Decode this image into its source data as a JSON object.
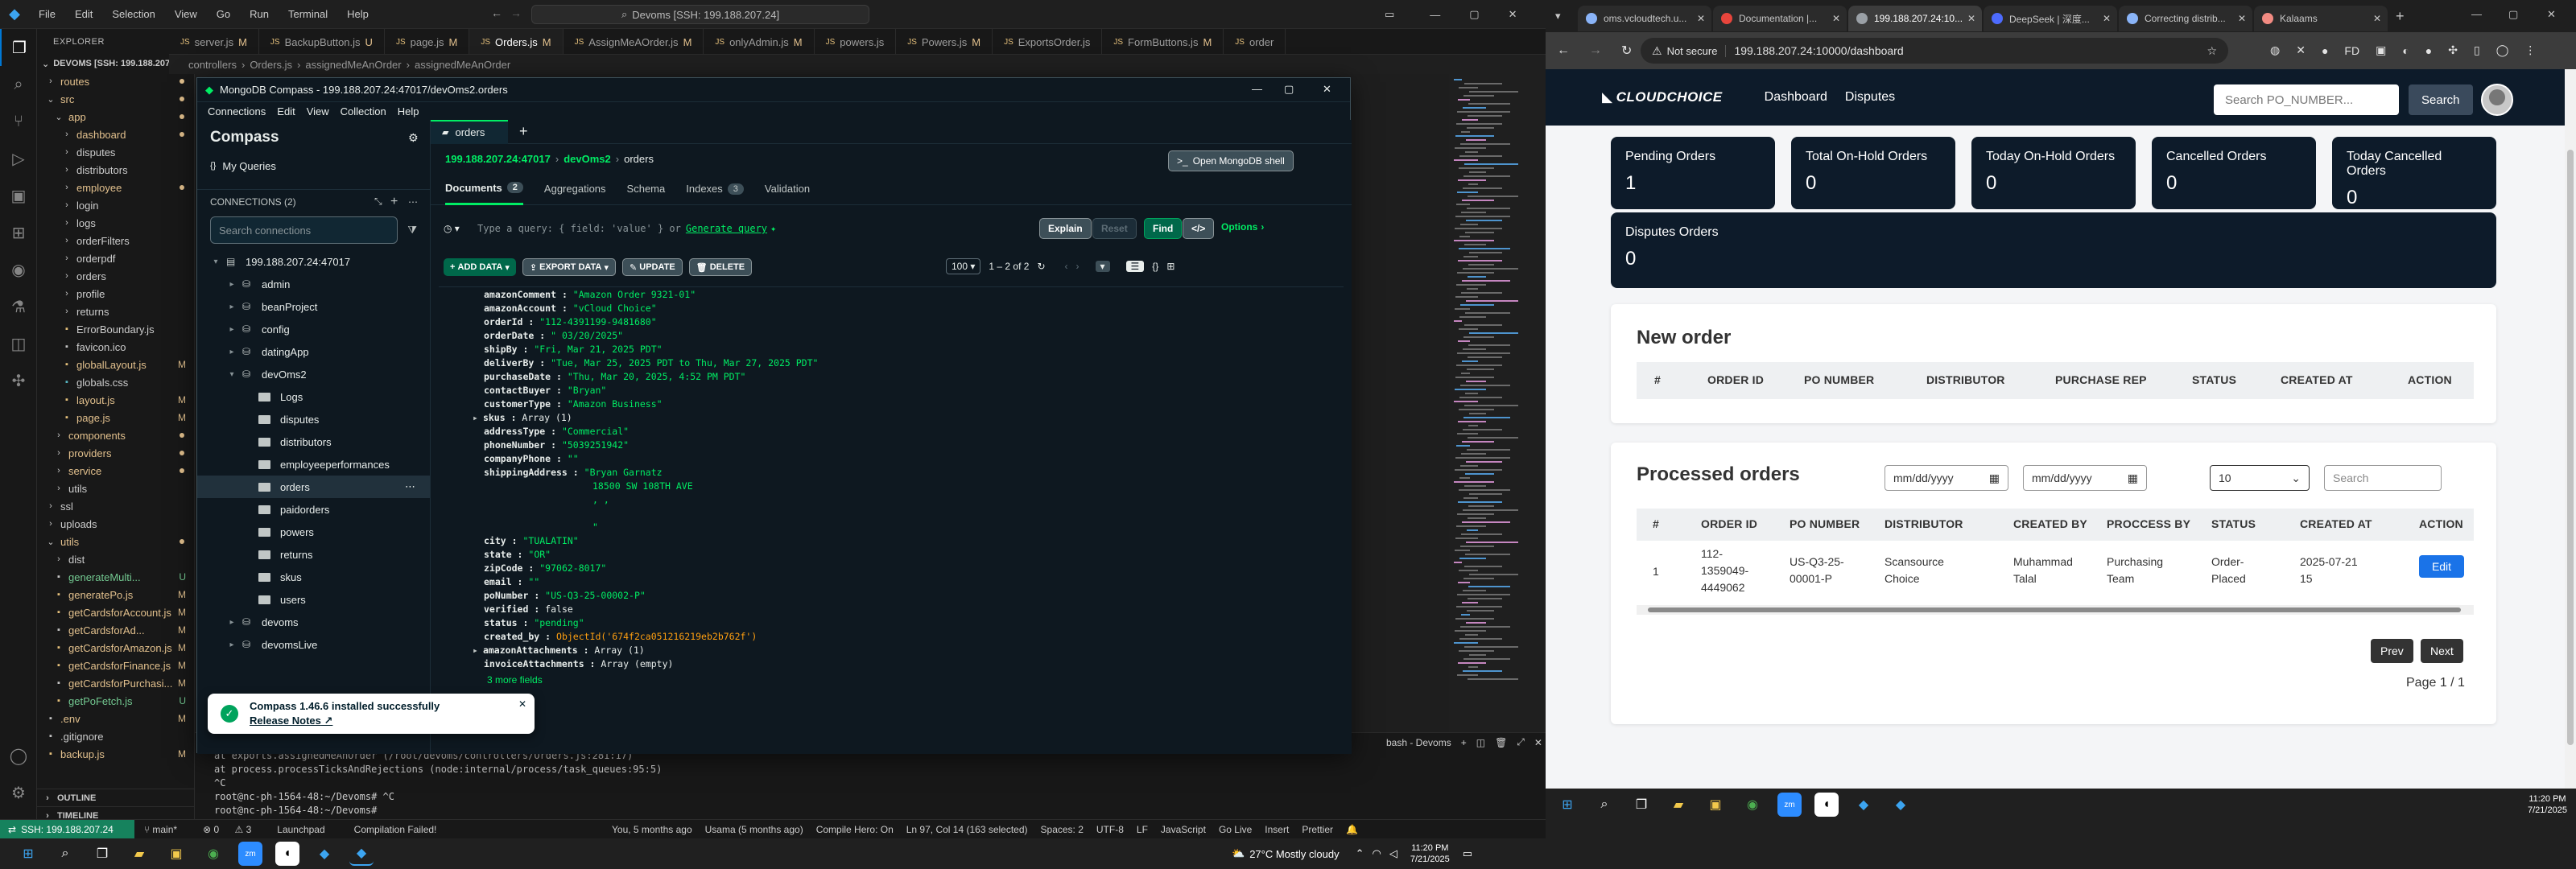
{
  "vscode": {
    "title": "Devoms [SSH: 199.188.207.24]",
    "menu": [
      "File",
      "Edit",
      "Selection",
      "View",
      "Go",
      "Run",
      "Terminal",
      "Help"
    ],
    "tabs": [
      {
        "label": "server.js",
        "mod": "M",
        "active": false
      },
      {
        "label": "BackupButton.js",
        "mod": "U",
        "active": false
      },
      {
        "label": "page.js",
        "mod": "M",
        "active": false
      },
      {
        "label": "Orders.js",
        "mod": "M",
        "active": true
      },
      {
        "label": "AssignMeAOrder.js",
        "mod": "M",
        "active": false
      },
      {
        "label": "onlyAdmin.js",
        "mod": "M",
        "active": false
      },
      {
        "label": "powers.js",
        "mod": "",
        "active": false
      },
      {
        "label": "Powers.js",
        "mod": "M",
        "active": false
      },
      {
        "label": "ExportsOrder.js",
        "mod": "",
        "active": false
      },
      {
        "label": "FormButtons.js",
        "mod": "M",
        "active": false
      },
      {
        "label": "order",
        "mod": "",
        "active": false
      }
    ],
    "breadcrumb": [
      "controllers",
      "Orders.js",
      "assignedMeAnOrder",
      "assignedMeAnOrder"
    ],
    "explorer_title": "EXPLORER",
    "root_label": "DEVOMS [SSH: 199.188.207.24]",
    "tree": [
      {
        "label": "routes",
        "indent": 1,
        "kind": "folder",
        "open": false,
        "mark": "dot"
      },
      {
        "label": "src",
        "indent": 1,
        "kind": "folder",
        "open": true,
        "mark": "dot"
      },
      {
        "label": "app",
        "indent": 2,
        "kind": "folder",
        "open": true,
        "mark": "dot"
      },
      {
        "label": "dashboard",
        "indent": 3,
        "kind": "folder",
        "open": false,
        "mark": "dot"
      },
      {
        "label": "disputes",
        "indent": 3,
        "kind": "folder",
        "open": false,
        "mark": ""
      },
      {
        "label": "distributors",
        "indent": 3,
        "kind": "folder",
        "open": false,
        "mark": ""
      },
      {
        "label": "employee",
        "indent": 3,
        "kind": "folder",
        "open": false,
        "mark": "dot"
      },
      {
        "label": "login",
        "indent": 3,
        "kind": "folder",
        "open": false,
        "mark": ""
      },
      {
        "label": "logs",
        "indent": 3,
        "kind": "folder",
        "open": false,
        "mark": ""
      },
      {
        "label": "orderFilters",
        "indent": 3,
        "kind": "folder",
        "open": false,
        "mark": ""
      },
      {
        "label": "orderpdf",
        "indent": 3,
        "kind": "folder",
        "open": false,
        "mark": ""
      },
      {
        "label": "orders",
        "indent": 3,
        "kind": "folder",
        "open": false,
        "mark": ""
      },
      {
        "label": "profile",
        "indent": 3,
        "kind": "folder",
        "open": false,
        "mark": ""
      },
      {
        "label": "returns",
        "indent": 3,
        "kind": "folder",
        "open": false,
        "mark": ""
      },
      {
        "label": "ErrorBoundary.js",
        "indent": 3,
        "kind": "file",
        "mark": ""
      },
      {
        "label": "favicon.ico",
        "indent": 3,
        "kind": "file",
        "mark": ""
      },
      {
        "label": "globalLayout.js",
        "indent": 3,
        "kind": "file",
        "mark": "M"
      },
      {
        "label": "globals.css",
        "indent": 3,
        "kind": "file",
        "mark": ""
      },
      {
        "label": "layout.js",
        "indent": 3,
        "kind": "file",
        "mark": "M"
      },
      {
        "label": "page.js",
        "indent": 3,
        "kind": "file",
        "mark": "M"
      },
      {
        "label": "components",
        "indent": 2,
        "kind": "folder",
        "open": false,
        "mark": "dot"
      },
      {
        "label": "providers",
        "indent": 2,
        "kind": "folder",
        "open": false,
        "mark": "dot"
      },
      {
        "label": "service",
        "indent": 2,
        "kind": "folder",
        "open": false,
        "mark": "dot"
      },
      {
        "label": "utils",
        "indent": 2,
        "kind": "folder",
        "open": false,
        "mark": ""
      },
      {
        "label": "ssl",
        "indent": 1,
        "kind": "folder",
        "open": false,
        "mark": ""
      },
      {
        "label": "uploads",
        "indent": 1,
        "kind": "folder",
        "open": false,
        "mark": ""
      },
      {
        "label": "utils",
        "indent": 1,
        "kind": "folder",
        "open": true,
        "mark": "dot"
      },
      {
        "label": "dist",
        "indent": 2,
        "kind": "folder",
        "open": false,
        "mark": ""
      },
      {
        "label": "generateMulti...",
        "indent": 2,
        "kind": "file",
        "mark": "U"
      },
      {
        "label": "generatePo.js",
        "indent": 2,
        "kind": "file",
        "mark": "M"
      },
      {
        "label": "getCardsforAccount.js",
        "indent": 2,
        "kind": "file",
        "mark": "M"
      },
      {
        "label": "getCardsforAd...",
        "indent": 2,
        "kind": "file",
        "mark": "M"
      },
      {
        "label": "getCardsforAmazon.js",
        "indent": 2,
        "kind": "file",
        "mark": "M"
      },
      {
        "label": "getCardsforFinance.js",
        "indent": 2,
        "kind": "file",
        "mark": "M"
      },
      {
        "label": "getCardsforPurchasi...",
        "indent": 2,
        "kind": "file",
        "mark": "M"
      },
      {
        "label": "getPoFetch.js",
        "indent": 2,
        "kind": "file",
        "mark": "U"
      },
      {
        "label": ".env",
        "indent": 1,
        "kind": "file",
        "mark": "M"
      },
      {
        "label": ".gitignore",
        "indent": 1,
        "kind": "file",
        "mark": ""
      },
      {
        "label": "backup.js",
        "indent": 1,
        "kind": "file",
        "mark": "M"
      }
    ],
    "outline": "OUTLINE",
    "timeline": "TIMELINE",
    "terminal_lines": [
      "at exports.assignedMeAnOrder (/root/devoms/controllers/Orders.js:281:17)",
      "at process.processTicksAndRejections (node:internal/process/task_queues:95:5)",
      "^C",
      "root@nc-ph-1564-48:~/Devoms# ^C",
      "root@nc-ph-1564-48:~/Devoms# "
    ],
    "terminal_tab": "bash - Devoms",
    "status": {
      "remote": "SSH: 199.188.207.24",
      "branch": "main*",
      "errors": "0",
      "warnings": "3",
      "launchpad": "Launchpad",
      "compile": "Compilation Failed!",
      "blame": "You, 5 months ago",
      "user": "Usama (5 months ago)",
      "compile_hero": "Compile Hero: On",
      "cursor": "Ln 97, Col 14 (163 selected)",
      "spaces": "Spaces: 2",
      "encoding": "UTF-8",
      "eol": "LF",
      "lang": "JavaScript",
      "golive": "Go Live",
      "insert": "Insert",
      "prettier": "Prettier"
    }
  },
  "compass": {
    "title": "MongoDB Compass - 199.188.207.24:47017/devOms2.orders",
    "menu": [
      "Connections",
      "Edit",
      "View",
      "Collection",
      "Help"
    ],
    "brand": "Compass",
    "my_queries": "My Queries",
    "connections_label": "CONNECTIONS (2)",
    "search_placeholder": "Search connections",
    "host": "199.188.207.24:47017",
    "databases": [
      {
        "label": "admin",
        "open": false
      },
      {
        "label": "beanProject",
        "open": false
      },
      {
        "label": "config",
        "open": false
      },
      {
        "label": "datingApp",
        "open": false
      },
      {
        "label": "devOms2",
        "open": true
      }
    ],
    "collections": [
      "Logs",
      "disputes",
      "distributors",
      "employeeperformances",
      "orders",
      "paidorders",
      "powers",
      "returns",
      "skus",
      "users"
    ],
    "other_dbs": [
      "devoms",
      "devomsLive"
    ],
    "selected_collection": "orders",
    "tab_label": "orders",
    "breadcrumb": {
      "host": "199.188.207.24:47017",
      "db": "devOms2",
      "coll": "orders"
    },
    "shell_button": "Open MongoDB shell",
    "subtabs": [
      {
        "label": "Documents",
        "count": "2",
        "active": true
      },
      {
        "label": "Aggregations",
        "count": "",
        "active": false
      },
      {
        "label": "Schema",
        "count": "",
        "active": false
      },
      {
        "label": "Indexes",
        "count": "3",
        "active": false
      },
      {
        "label": "Validation",
        "count": "",
        "active": false
      }
    ],
    "query_placeholder": "Type a query: { field: 'value' } or",
    "generate_query": "Generate query",
    "explain": "Explain",
    "reset": "Reset",
    "find": "Find",
    "options": "Options",
    "add_data": "ADD DATA",
    "export_data": "EXPORT DATA",
    "update": "UPDATE",
    "delete": "DELETE",
    "page_size": "100",
    "page_range": "1 – 2 of 2",
    "document_lines": [
      {
        "k": "amazonComment",
        "v": "\"Amazon Order 9321-01\"",
        "t": "s",
        "ind": 0
      },
      {
        "k": "amazonAccount",
        "v": "\"vCloud Choice\"",
        "t": "s",
        "ind": 0
      },
      {
        "k": "orderId",
        "v": "\"112-4391199-9481680\"",
        "t": "s",
        "ind": 0
      },
      {
        "k": "orderDate",
        "v": "\" 03/20/2025\"",
        "t": "s",
        "ind": 0
      },
      {
        "k": "shipBy",
        "v": "\"Fri, Mar 21, 2025 PDT\"",
        "t": "s",
        "ind": 0
      },
      {
        "k": "deliverBy",
        "v": "\"Tue, Mar 25, 2025 PDT to Thu, Mar 27, 2025 PDT\"",
        "t": "s",
        "ind": 0
      },
      {
        "k": "purchaseDate",
        "v": "\"Thu, Mar 20, 2025, 4:52 PM PDT\"",
        "t": "s",
        "ind": 0
      },
      {
        "k": "contactBuyer",
        "v": "\"Bryan\"",
        "t": "s",
        "ind": 0
      },
      {
        "k": "customerType",
        "v": "\"Amazon Business\"",
        "t": "s",
        "ind": 0
      },
      {
        "k": "skus",
        "v": "Array (1)",
        "t": "k",
        "ind": -1
      },
      {
        "k": "addressType",
        "v": "\"Commercial\"",
        "t": "s",
        "ind": 0
      },
      {
        "k": "phoneNumber",
        "v": "\"5039251942\"",
        "t": "s",
        "ind": 0
      },
      {
        "k": "companyPhone",
        "v": "\"\"",
        "t": "s",
        "ind": 0
      },
      {
        "k": "shippingAddress",
        "v": "\"Bryan Garnatz",
        "t": "s",
        "ind": 0
      },
      {
        "k": "",
        "v": "18500 SW 108TH AVE",
        "t": "s",
        "ind": 9
      },
      {
        "k": "",
        "v": ", ,",
        "t": "s",
        "ind": 9
      },
      {
        "k": "",
        "v": "",
        "t": "s",
        "ind": 9
      },
      {
        "k": "",
        "v": "\"",
        "t": "s",
        "ind": 9
      },
      {
        "k": "city",
        "v": "\"TUALATIN\"",
        "t": "s",
        "ind": 0
      },
      {
        "k": "state",
        "v": "\"OR\"",
        "t": "s",
        "ind": 0
      },
      {
        "k": "zipCode",
        "v": "\"97062-8017\"",
        "t": "s",
        "ind": 0
      },
      {
        "k": "email",
        "v": "\"\"",
        "t": "s",
        "ind": 0
      },
      {
        "k": "poNumber",
        "v": "\"US-Q3-25-00002-P\"",
        "t": "s",
        "ind": 0
      },
      {
        "k": "verified",
        "v": "false",
        "t": "k",
        "ind": 0
      },
      {
        "k": "status",
        "v": "\"pending\"",
        "t": "s",
        "ind": 0
      },
      {
        "k": "created_by",
        "v": "ObjectId('674f2ca051216219eb2b762f')",
        "t": "o",
        "ind": 0
      },
      {
        "k": "amazonAttachments",
        "v": "Array (1)",
        "t": "k",
        "ind": -1
      },
      {
        "k": "invoiceAttachments",
        "v": "Array (empty)",
        "t": "k",
        "ind": 0
      }
    ],
    "more_fields": "3 more fields",
    "toast_title": "Compass 1.46.6 installed successfully",
    "toast_link": "Release Notes"
  },
  "chrome": {
    "tabs": [
      {
        "label": "oms.vcloudtech.u...",
        "color": "#8ab4f8",
        "active": false
      },
      {
        "label": "Documentation |...",
        "color": "#e8453c",
        "active": false
      },
      {
        "label": "199.188.207.24:10...",
        "color": "#9aa0a6",
        "active": true
      },
      {
        "label": "DeepSeek | 深度...",
        "color": "#4d6bfe",
        "active": false
      },
      {
        "label": "Correcting distrib...",
        "color": "#8ab4f8",
        "active": false
      },
      {
        "label": "Kalaams",
        "color": "#f28b82",
        "active": false
      }
    ],
    "not_secure": "Not secure",
    "url": "199.188.207.24:10000/dashboard"
  },
  "app": {
    "logo": "CLOUDCHOICE",
    "nav": [
      "Dashboard",
      "Disputes"
    ],
    "search_placeholder": "Search PO_NUMBER...",
    "search_button": "Search",
    "cards": [
      {
        "title": "Pending Orders",
        "value": "1"
      },
      {
        "title": "Total On-Hold Orders",
        "value": "0"
      },
      {
        "title": "Today On-Hold Orders",
        "value": "0"
      },
      {
        "title": "Cancelled Orders",
        "value": "0"
      },
      {
        "title": "Today Cancelled Orders",
        "value": "0"
      }
    ],
    "disputes_card": {
      "title": "Disputes Orders",
      "value": "0"
    },
    "new_order": {
      "title": "New order",
      "columns": [
        "#",
        "ORDER ID",
        "PO NUMBER",
        "DISTRIBUTOR",
        "PURCHASE REP",
        "STATUS",
        "CREATED AT",
        "ACTION"
      ]
    },
    "processed": {
      "title": "Processed orders",
      "date_placeholder": "mm/dd/yyyy",
      "page_size": "10",
      "search_placeholder": "Search",
      "columns": [
        "#",
        "ORDER ID",
        "PO NUMBER",
        "DISTRIBUTOR",
        "CREATED BY",
        "PROCCESS BY",
        "STATUS",
        "CREATED AT",
        "ACTION"
      ],
      "row": {
        "num": "1",
        "order_id": "112-1359049-4449062",
        "po": "US-Q3-25-00001-P",
        "distributor": "Scansource Choice",
        "created_by": "Muhammad Talal",
        "process_by": "Purchasing Team",
        "status": "Order-Placed",
        "created_at": "2025-07-21 15",
        "action": "Edit"
      },
      "prev": "Prev",
      "next": "Next",
      "page": "Page 1 / 1"
    }
  },
  "taskbar_left": {
    "weather": "27°C  Mostly cloudy",
    "time": "11:20 PM",
    "date": "7/21/2025"
  },
  "taskbar_right": {
    "time": "11:20 PM",
    "date": "7/21/2025"
  }
}
